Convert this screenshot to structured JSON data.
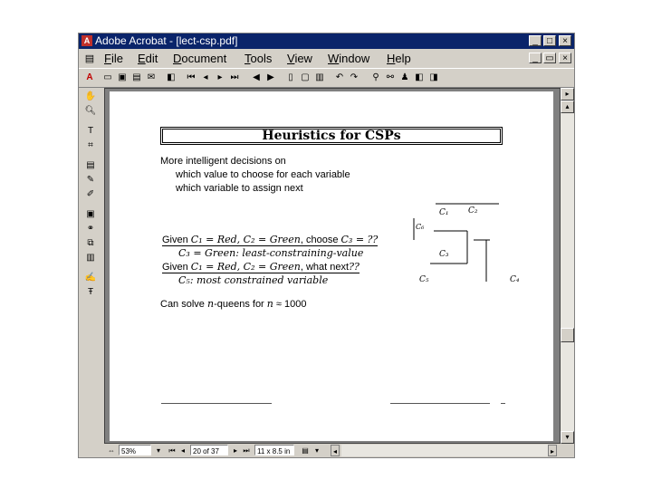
{
  "window": {
    "title": "Adobe Acrobat - [lect-csp.pdf]",
    "app_icon": "acrobat-icon",
    "controls": [
      "_",
      "□",
      "×"
    ],
    "doc_controls": [
      "_",
      "▭",
      "×"
    ]
  },
  "menu": [
    "File",
    "Edit",
    "Document",
    "Tools",
    "View",
    "Window",
    "Help"
  ],
  "slide": {
    "title": "Heuristics for CSPs",
    "intro": "More intelligent decisions on",
    "bullet1": "which value to choose for each variable",
    "bullet2": "which variable to assign next",
    "given1": {
      "pre": "Given ",
      "assign": "C₁ = Red, C₂ = Green",
      "mid": ", choose ",
      "q": "C₃ = ??"
    },
    "answer1": {
      "lhs": "C₃ = Green",
      "rhs": ": least-constraining-value"
    },
    "given2": {
      "pre": "Given ",
      "assign": "C₁ = Red, C₂ = Green",
      "mid": ", what next",
      "q": "??"
    },
    "answer2": {
      "lhs": "C₅",
      "rhs": ": most constrained variable"
    },
    "nqueens": {
      "pre": "Can solve ",
      "n": "n",
      "post": "-queens for ",
      "n2": "n",
      "approx": " ≈ 1000"
    },
    "map_labels": {
      "c1": "C₁",
      "c2": "C₂",
      "c3": "C₃",
      "c4": "C₄",
      "c5": "C₅",
      "c6": "C₆"
    }
  },
  "status": {
    "zoom": "53%",
    "page": "20 of 37",
    "size": "11 x 8.5 in"
  }
}
